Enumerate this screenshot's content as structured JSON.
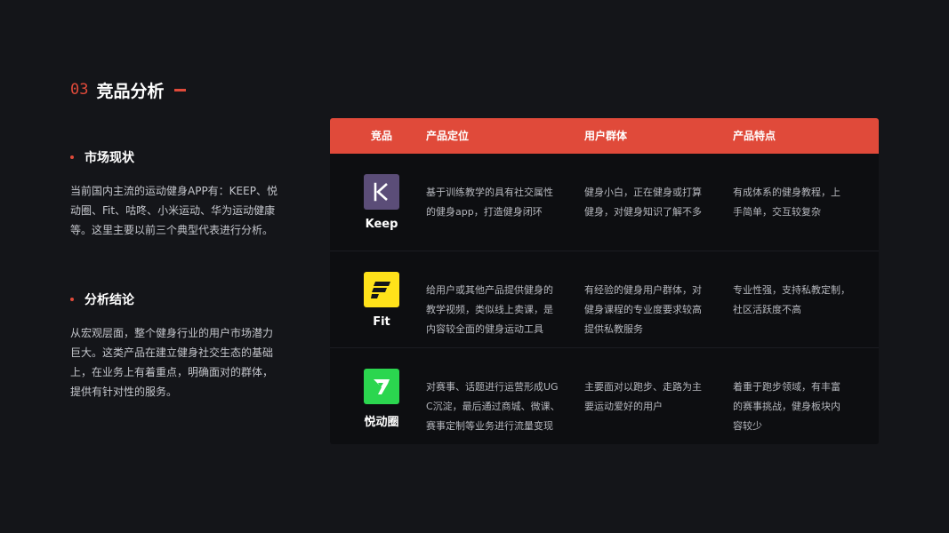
{
  "header": {
    "number": "03",
    "title": "竞品分析"
  },
  "market": {
    "heading": "市场现状",
    "lines": [
      "当前国内主流的运动健身APP有：KEEP、悦",
      "动圈、Fit、咕咚、小米运动、华为运动健康",
      "等。这里主要以前三个典型代表进行分析。"
    ]
  },
  "conclusion": {
    "heading": "分析结论",
    "lines": [
      "从宏观层面，整个健身行业的用户市场潜力",
      "巨大。这类产品在建立健身社交生态的基础",
      "上，在业务上有着重点，明确面对的群体，",
      "提供有针对性的服务。"
    ]
  },
  "table": {
    "headers": [
      "竞品",
      "产品定位",
      "用户群体",
      "产品特点"
    ],
    "rows": [
      {
        "name": "Keep",
        "icon": "keep-logo-icon",
        "color": "#5b4d78",
        "positioning": [
          "基于训练教学的具有社交属性",
          "的健身app，打造健身闭环"
        ],
        "users": [
          "健身小白，正在健身或打算",
          "健身，对健身知识了解不多"
        ],
        "features": [
          "有成体系的健身教程，上",
          "手简单，交互较复杂"
        ]
      },
      {
        "name": "Fit",
        "icon": "fit-logo-icon",
        "color": "#ffe21a",
        "positioning": [
          "给用户或其他产品提供健身的",
          "教学视频，类似线上卖课，是",
          "内容较全面的健身运动工具"
        ],
        "users": [
          "有经验的健身用户群体，对",
          "健身课程的专业度要求较高",
          "提供私教服务"
        ],
        "features": [
          "专业性强，支持私教定制，",
          "社区活跃度不高"
        ]
      },
      {
        "name": "悦动圈",
        "icon": "yuedongquan-logo-icon",
        "color": "#2bd64f",
        "positioning": [
          "对赛事、话题进行运营形成UG",
          "C沉淀，最后通过商城、微课、",
          "赛事定制等业务进行流量变现"
        ],
        "users": [
          "主要面对以跑步、走路为主",
          "要运动爱好的用户"
        ],
        "features": [
          "着重于跑步领域，有丰富",
          "的赛事挑战，健身板块内",
          "容较少"
        ]
      }
    ]
  }
}
